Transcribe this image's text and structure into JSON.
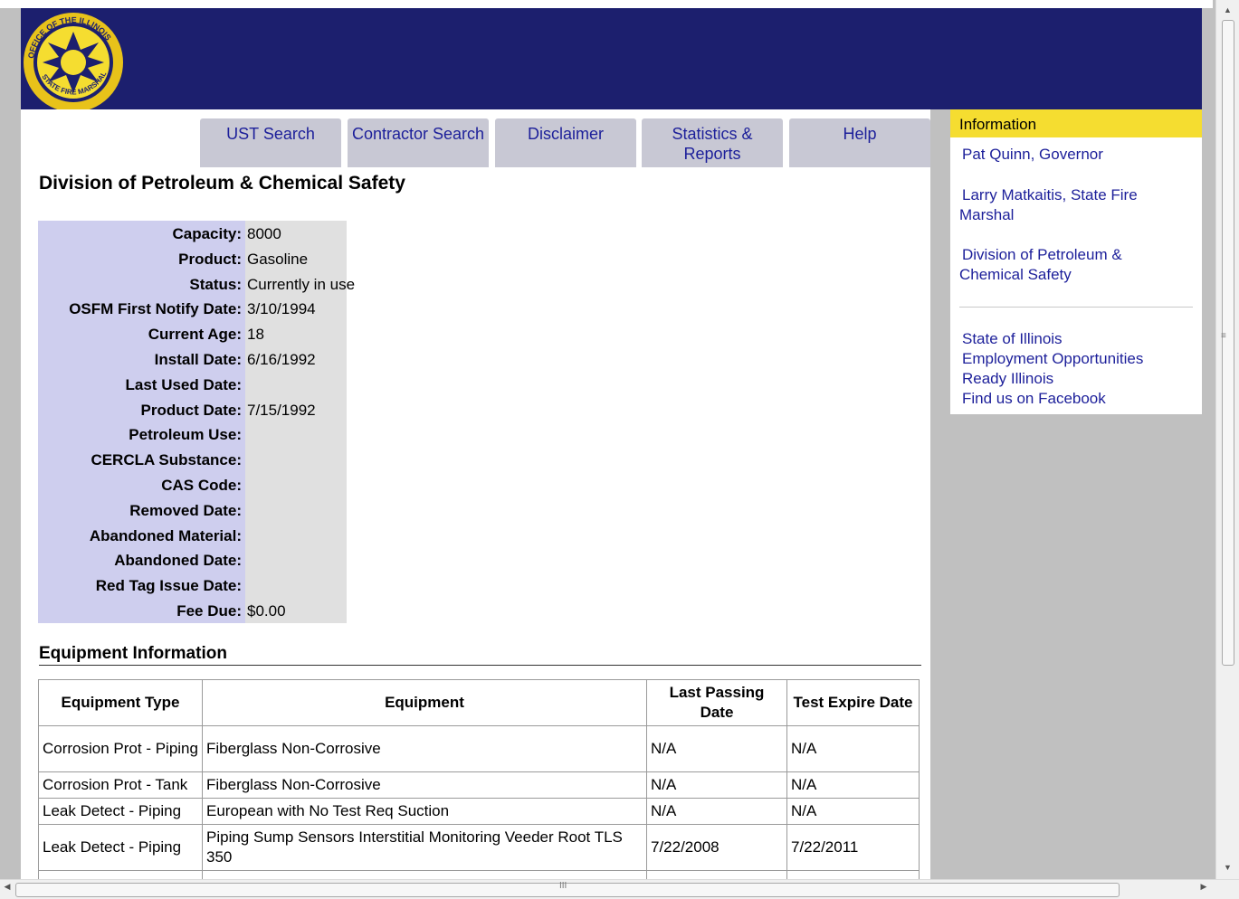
{
  "header": {
    "seal_text": "OFFICE OF THE ILLINOIS STATE FIRE MARSHAL"
  },
  "tabs": [
    {
      "label": "UST Search"
    },
    {
      "label": "Contractor Search"
    },
    {
      "label": "Disclaimer"
    },
    {
      "label": "Statistics & Reports"
    },
    {
      "label": "Help"
    }
  ],
  "page_title": "Division of Petroleum & Chemical Safety",
  "details": [
    {
      "label": "Capacity:",
      "value": "8000"
    },
    {
      "label": "Product:",
      "value": "Gasoline"
    },
    {
      "label": "Status:",
      "value": "Currently in use"
    },
    {
      "label": "OSFM First Notify Date:",
      "value": "3/10/1994"
    },
    {
      "label": "Current Age:",
      "value": "18"
    },
    {
      "label": "Install Date:",
      "value": "6/16/1992"
    },
    {
      "label": "Last Used Date:",
      "value": ""
    },
    {
      "label": "Product Date:",
      "value": "7/15/1992"
    },
    {
      "label": "Petroleum Use:",
      "value": ""
    },
    {
      "label": "CERCLA Substance:",
      "value": ""
    },
    {
      "label": "CAS Code:",
      "value": ""
    },
    {
      "label": "Removed Date:",
      "value": ""
    },
    {
      "label": "Abandoned Material:",
      "value": ""
    },
    {
      "label": "Abandoned Date:",
      "value": ""
    },
    {
      "label": "Red Tag Issue Date:",
      "value": ""
    },
    {
      "label": "Fee Due:",
      "value": "$0.00"
    }
  ],
  "equipment": {
    "title": "Equipment Information",
    "headers": [
      "Equipment Type",
      "Equipment",
      "Last Passing Date",
      "Test Expire Date"
    ],
    "rows": [
      [
        "Corrosion Prot - Piping",
        "Fiberglass Non-Corrosive",
        "N/A",
        "N/A"
      ],
      [
        "Corrosion Prot - Tank",
        "Fiberglass Non-Corrosive",
        "N/A",
        "N/A"
      ],
      [
        "Leak Detect - Piping",
        "European with No Test Req Suction",
        "N/A",
        "N/A"
      ],
      [
        "Leak Detect - Piping",
        "Piping Sump Sensors Interstitial Monitoring Veeder Root TLS 350",
        "7/22/2008",
        "7/22/2011"
      ]
    ]
  },
  "sidebar": {
    "heading": "Information",
    "links": [
      "Pat Quinn, Governor",
      "Larry Matkaitis, State Fire Marshal",
      "Division of Petroleum & Chemical Safety",
      "State of Illinois",
      "Employment Opportunities",
      "Ready Illinois",
      "Find us on Facebook"
    ]
  },
  "colors": {
    "header_bg": "#1c1f6e",
    "tab_bg": "#c8c8d4",
    "link": "#1c1f9a",
    "label_bg": "#ceceee",
    "sidebar_head": "#f5dd30"
  }
}
